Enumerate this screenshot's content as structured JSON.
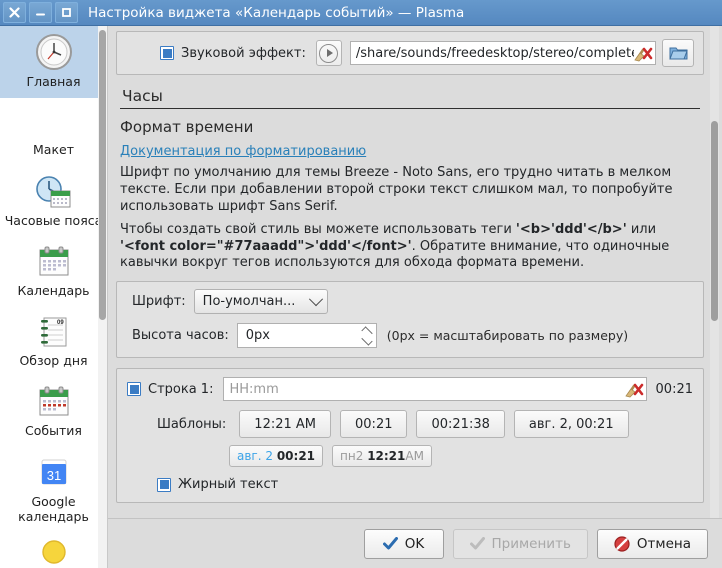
{
  "window": {
    "title": "Настройка виджета «Календарь событий» — Plasma",
    "controls": {
      "close": "✕",
      "minimize": "—",
      "maximize": "□"
    }
  },
  "sidebar": {
    "items": [
      {
        "label": "Главная",
        "icon": "analog-clock-icon",
        "selected": true
      },
      {
        "label": "Макет",
        "icon": "layout-icon",
        "selected": false
      },
      {
        "label": "Часовые пояса",
        "icon": "clock-calendar-icon",
        "selected": false
      },
      {
        "label": "Календарь",
        "icon": "calendar-icon",
        "selected": false
      },
      {
        "label": "Обзор дня",
        "icon": "notebook-icon",
        "selected": false
      },
      {
        "label": "События",
        "icon": "events-calendar-icon",
        "selected": false
      },
      {
        "label": "Google календарь",
        "icon": "google-calendar-31-icon",
        "selected": false
      },
      {
        "label": "",
        "icon": "sun-icon",
        "selected": false
      }
    ]
  },
  "content": {
    "sound_effect": {
      "checkbox_label": "Звуковой эффект:",
      "checked": true,
      "play_icon": "play-icon",
      "path_value": "/share/sounds/freedesktop/stereo/complete.o",
      "clear_icon": "broom-clear-icon",
      "browse_icon": "folder-open-icon"
    },
    "section_header": "Часы",
    "sub_header": "Формат времени",
    "doc_link": "Документация по форматированию",
    "paragraph1": "Шрифт по умолчанию для темы Breeze - Noto Sans, его трудно читать в мелком тексте. Если при добавлении второй строки текст слишком мал, то попробуйте использовать шрифт Sans Serif.",
    "paragraph2_parts": {
      "p1": "Чтобы создать свой стиль вы можете использовать теги ",
      "b1": "'<b>'ddd'</b>'",
      "p2": " или ",
      "b2": "'<font color=\"#77aaadd\">'ddd'</font>'",
      "p3": ". Обратите внимание, что одиночные кавычки вокруг тегов используются для обхода формата времени."
    },
    "font_row": {
      "label": "Шрифт:",
      "value": "По-умолчан...",
      "chevron": "chevron-down-icon"
    },
    "clock_height_row": {
      "label": "Высота часов:",
      "value": "0px",
      "hint": "(0px = масштабировать по размеру)"
    },
    "line1": {
      "checkbox_label": "Строка 1:",
      "checked": true,
      "placeholder": "HH:mm",
      "value": "",
      "clear_icon": "broom-clear-icon",
      "preview": "00:21"
    },
    "templates": {
      "label": "Шаблоны:",
      "row1": [
        "12:21 AM",
        "00:21",
        "00:21:38",
        "авг. 2, 00:21"
      ],
      "row2": [
        {
          "parts": [
            {
              "text": "авг. 2",
              "style": "blue"
            },
            {
              "text": " ",
              "style": "plain"
            },
            {
              "text": "00:21",
              "style": "bold"
            }
          ]
        },
        {
          "parts": [
            {
              "text": "пн2",
              "style": "gray"
            },
            {
              "text": " ",
              "style": "plain"
            },
            {
              "text": "12:21",
              "style": "bold"
            },
            {
              "text": "AM",
              "style": "gray"
            }
          ]
        }
      ]
    },
    "bold_text": {
      "label": "Жирный текст",
      "checked": true
    }
  },
  "buttons": {
    "ok": {
      "label": "OK",
      "icon": "check-icon",
      "enabled": true
    },
    "apply": {
      "label": "Применить",
      "icon": "check-icon",
      "enabled": false
    },
    "cancel": {
      "label": "Отмена",
      "icon": "cancel-icon",
      "enabled": true
    }
  },
  "colors": {
    "titlebar": "#6699cc",
    "selection": "#bcd3ea",
    "accent_blue": "#3b7cc4",
    "link": "#2980b9",
    "cancel_red": "#c0392b",
    "window_bg": "#dcdcdc"
  }
}
